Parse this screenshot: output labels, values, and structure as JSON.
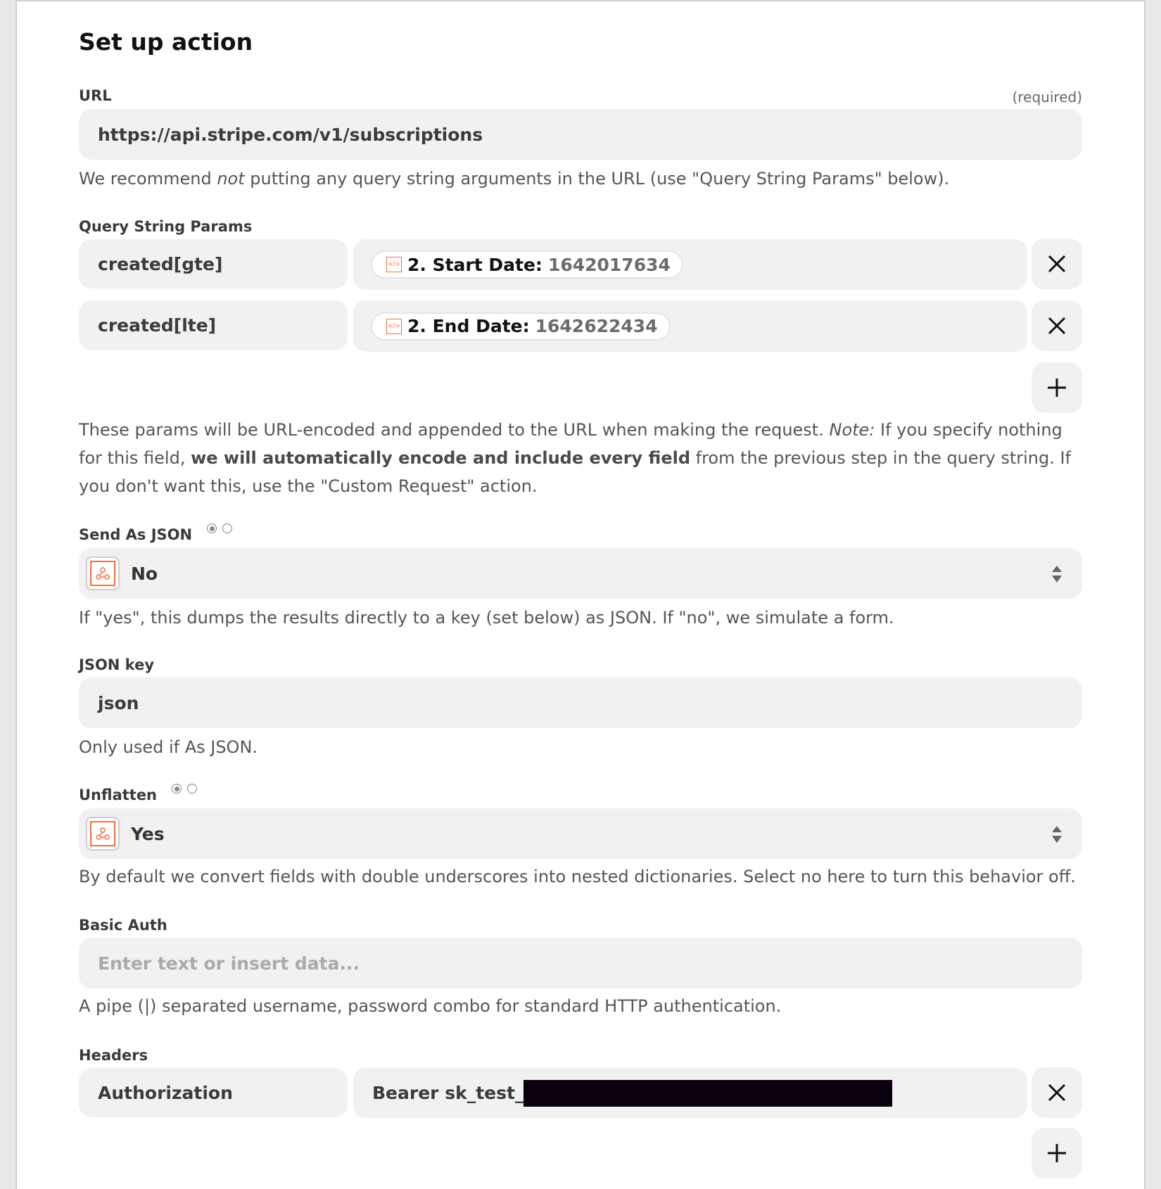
{
  "title": "Set up action",
  "url_field": {
    "label": "URL",
    "required": "(required)",
    "value": "https://api.stripe.com/v1/subscriptions",
    "help_pre": "We recommend ",
    "help_em": "not",
    "help_post": " putting any query string arguments in the URL (use \"Query String Params\" below)."
  },
  "query_params": {
    "label": "Query String Params",
    "rows": [
      {
        "key": "created[gte]",
        "pill_key": "2. Start Date:",
        "pill_value": "1642017634"
      },
      {
        "key": "created[lte]",
        "pill_key": "2. End Date:",
        "pill_value": "1642622434"
      }
    ],
    "remove_icon": "close-icon",
    "add_icon": "plus-icon",
    "help_1": "These params will be URL-encoded and appended to the URL when making the request. ",
    "help_note": "Note:",
    "help_2": " If you specify nothing for this field, ",
    "help_bold": "we will automatically encode and include every field",
    "help_3": " from the previous step in the query string. If you don't want this, use the \"Custom Request\" action."
  },
  "send_as_json": {
    "label": "Send As JSON",
    "value": "No",
    "help": "If \"yes\", this dumps the results directly to a key (set below) as JSON. If \"no\", we simulate a form."
  },
  "json_key": {
    "label": "JSON key",
    "value": "json",
    "help": "Only used if As JSON."
  },
  "unflatten": {
    "label": "Unflatten",
    "value": "Yes",
    "help": "By default we convert fields with double underscores into nested dictionaries. Select no here to turn this behavior off."
  },
  "basic_auth": {
    "label": "Basic Auth",
    "placeholder": "Enter text or insert data...",
    "help": "A pipe (|) separated username, password combo for standard HTTP authentication."
  },
  "headers": {
    "label": "Headers",
    "rows": [
      {
        "key": "Authorization",
        "value": "Bearer sk_test_"
      }
    ]
  },
  "colors": {
    "accent": "#ff6a3d",
    "field_bg": "#f1f1f1",
    "redaction": "#0b000d"
  }
}
